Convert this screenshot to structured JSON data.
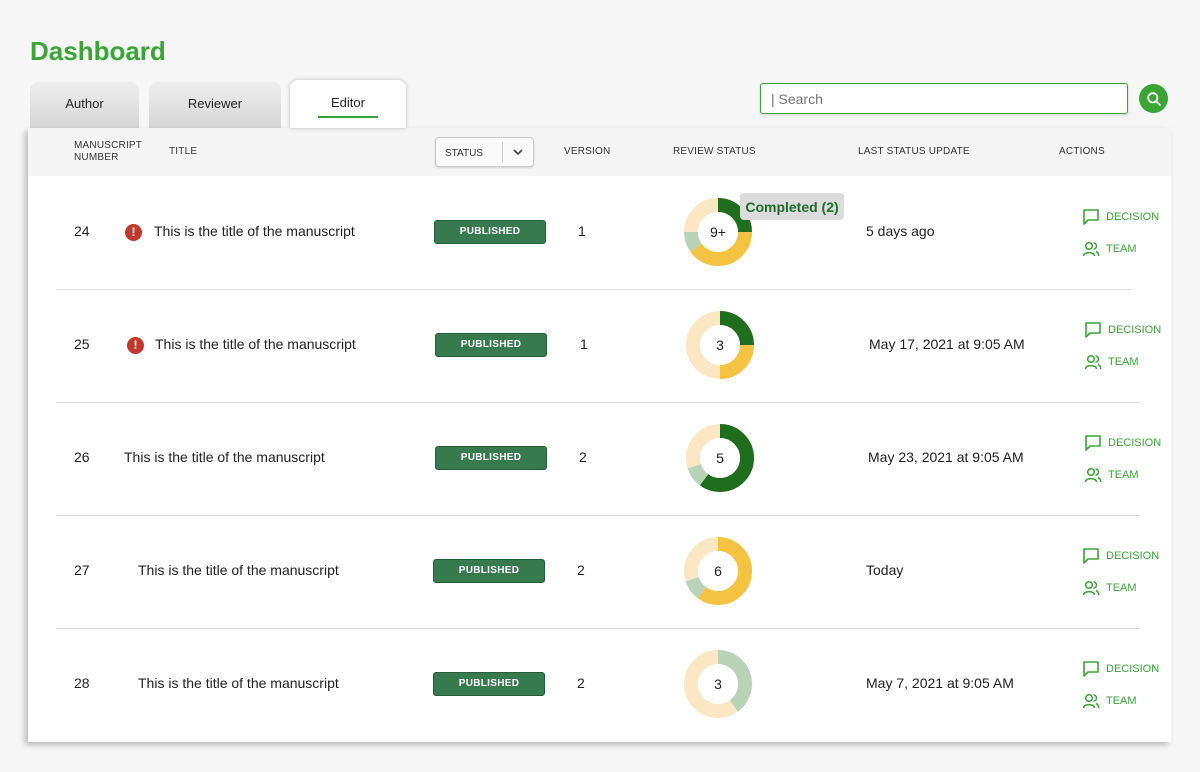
{
  "page": {
    "title": "Dashboard"
  },
  "tabs": [
    {
      "label": "Author",
      "active": false
    },
    {
      "label": "Reviewer",
      "active": false
    },
    {
      "label": "Editor",
      "active": true
    }
  ],
  "search": {
    "placeholder": "| Search",
    "value": ""
  },
  "table": {
    "headers": {
      "manuscript_number": "MANUSCRIPT NUMBER",
      "title": "TITLE",
      "status": "STATUS",
      "version": "VERSION",
      "review_status": "REVIEW STATUS",
      "last_status_update": "LAST STATUS UPDATE",
      "actions": "ACTIONS"
    },
    "rows": [
      {
        "number": "24",
        "has_alert": true,
        "title": "This is the title of the manuscript",
        "status": "PUBLISHED",
        "version": "1",
        "review_count": "9+",
        "last_update": "5 days ago",
        "decision_label": "DECISION",
        "team_label": "TEAM",
        "review_segments": [
          {
            "status": "completed",
            "fraction": 0.25
          },
          {
            "status": "in-progress",
            "fraction": 0.4
          },
          {
            "status": "declined",
            "fraction": 0.1
          },
          {
            "status": "invited",
            "fraction": 0.25
          }
        ]
      },
      {
        "number": "25",
        "has_alert": true,
        "title": "This is the title of the manuscript",
        "status": "PUBLISHED",
        "version": "1",
        "review_count": "3",
        "last_update": "May 17, 2021 at 9:05 AM",
        "decision_label": "DECISION",
        "team_label": "TEAM",
        "review_segments": [
          {
            "status": "completed",
            "fraction": 0.25
          },
          {
            "status": "in-progress",
            "fraction": 0.25
          },
          {
            "status": "invited",
            "fraction": 0.5
          }
        ]
      },
      {
        "number": "26",
        "has_alert": false,
        "title": "This is the title of the manuscript",
        "status": "PUBLISHED",
        "version": "2",
        "review_count": "5",
        "last_update": "May 23, 2021 at 9:05 AM",
        "decision_label": "DECISION",
        "team_label": "TEAM",
        "review_segments": [
          {
            "status": "completed",
            "fraction": 0.6
          },
          {
            "status": "declined",
            "fraction": 0.1
          },
          {
            "status": "invited",
            "fraction": 0.3
          }
        ]
      },
      {
        "number": "27",
        "has_alert": false,
        "title": "This is the title of the manuscript",
        "status": "PUBLISHED",
        "version": "2",
        "review_count": "6",
        "last_update": "Today",
        "decision_label": "DECISION",
        "team_label": "TEAM",
        "review_segments": [
          {
            "status": "in-progress",
            "fraction": 0.6
          },
          {
            "status": "declined",
            "fraction": 0.1
          },
          {
            "status": "invited",
            "fraction": 0.3
          }
        ]
      },
      {
        "number": "28",
        "has_alert": false,
        "title": "This is the title of the manuscript",
        "status": "PUBLISHED",
        "version": "2",
        "review_count": "3",
        "last_update": "May 7, 2021 at 9:05 AM",
        "decision_label": "DECISION",
        "team_label": "TEAM",
        "review_segments": [
          {
            "status": "declined",
            "fraction": 0.4
          },
          {
            "status": "invited",
            "fraction": 0.6
          }
        ]
      }
    ]
  },
  "tooltip": {
    "text": "Completed (2)"
  },
  "colors": {
    "brand_green": "#3aa535",
    "badge_green": "#367a4e",
    "completed": "#1e6e1e",
    "in-progress": "#f5c342",
    "declined": "#b9d3b9",
    "invited": "#fbe7c4",
    "alert": "#c0392b"
  }
}
